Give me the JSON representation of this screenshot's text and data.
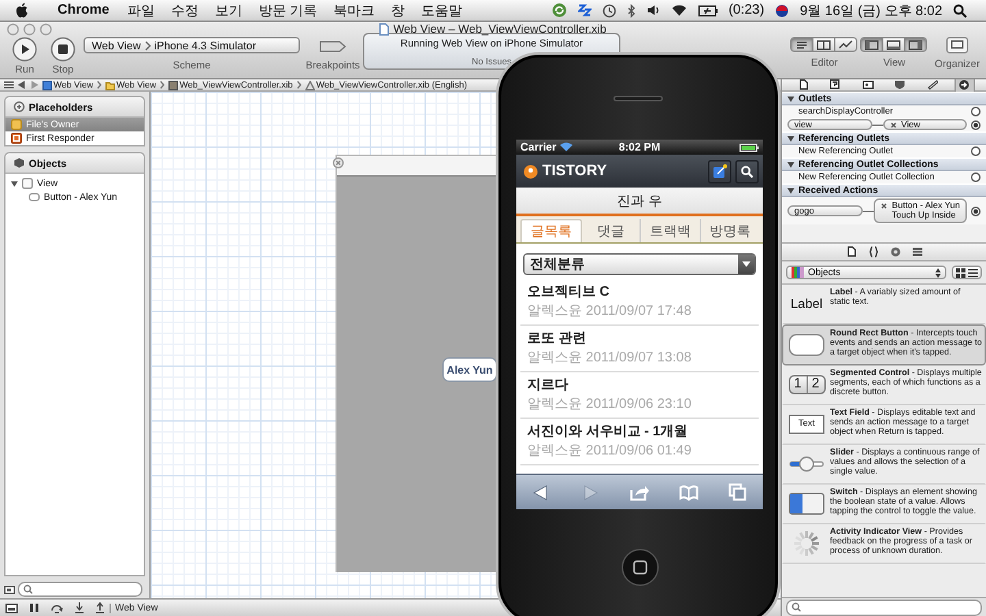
{
  "menu_bar": {
    "app": "Chrome",
    "menus": [
      "파일",
      "수정",
      "보기",
      "방문 기록",
      "북마크",
      "창",
      "도움말"
    ],
    "battery": "(0:23)",
    "clock": "9월 16일 (금) 오후 8:02"
  },
  "window": {
    "title": "Web View – Web_ViewViewController.xib"
  },
  "toolbar": {
    "run": "Run",
    "stop": "Stop",
    "scheme": {
      "target": "Web View",
      "destination": "iPhone 4.3 Simulator",
      "label": "Scheme"
    },
    "breakpoints": "Breakpoints",
    "activity": {
      "status": "Running Web View on iPhone Simulator",
      "issues": "No Issues"
    },
    "editor": {
      "label": "Editor",
      "modes": [
        {
          "selected": true
        },
        {
          "selected": false
        },
        {
          "selected": false
        }
      ]
    },
    "view": {
      "label": "View",
      "panes": [
        {
          "selected": true
        },
        {
          "selected": false
        },
        {
          "selected": true
        }
      ]
    },
    "organizer": "Organizer"
  },
  "jump_bar": {
    "path": [
      "Web View",
      "Web View",
      "Web_ViewViewController.xib",
      "Web_ViewViewController.xib (English)"
    ]
  },
  "outline": {
    "sections": [
      {
        "title": "Placeholders",
        "items": [
          {
            "label": "File's Owner",
            "kind": "owner",
            "selected": true
          },
          {
            "label": "First Responder",
            "kind": "responder",
            "selected": false
          }
        ]
      },
      {
        "title": "Objects",
        "items": [
          {
            "label": "View",
            "kind": "view",
            "selected": false,
            "expanded": true,
            "children": [
              {
                "label": "Button - Alex Yun",
                "kind": "button",
                "selected": false
              }
            ]
          }
        ]
      }
    ]
  },
  "canvas": {
    "button": "Alex Yun"
  },
  "debug_bar": {
    "target": "Web View"
  },
  "simulator": {
    "carrier": "Carrier",
    "time": "8:02 PM",
    "logo": "TISTORY",
    "blog_title": "진과 우",
    "tabs": [
      {
        "label": "글목록",
        "selected": true
      },
      {
        "label": "댓글",
        "selected": false
      },
      {
        "label": "트랙백",
        "selected": false
      },
      {
        "label": "방명록",
        "selected": false
      }
    ],
    "category": "전체분류",
    "posts": [
      {
        "title": "오브젝티브 C",
        "meta": "알렉스윤 2011/09/07 17:48"
      },
      {
        "title": "로또 관련",
        "meta": "알렉스윤 2011/09/07 13:08"
      },
      {
        "title": "지르다",
        "meta": "알렉스윤 2011/09/06 23:10"
      },
      {
        "title": "서진이와 서우비교 - 1개월",
        "meta": "알렉스윤 2011/09/06 01:49"
      }
    ],
    "forward_disabled": true
  },
  "inspector": {
    "tabs": [
      {
        "selected": false
      },
      {
        "selected": false
      },
      {
        "selected": false
      },
      {
        "selected": false
      },
      {
        "selected": false
      },
      {
        "selected": true
      }
    ],
    "sections": [
      {
        "title": "Outlets",
        "rows": [
          {
            "name": "searchDisplayController",
            "connected": false
          },
          {
            "name": "view",
            "connected": true,
            "target": "View"
          }
        ]
      },
      {
        "title": "Referencing Outlets",
        "rows": [
          {
            "name": "New Referencing Outlet",
            "connected": false
          }
        ]
      },
      {
        "title": "Referencing Outlet Collections",
        "rows": [
          {
            "name": "New Referencing Outlet Collection",
            "connected": false
          }
        ]
      },
      {
        "title": "Received Actions",
        "rows": [
          {
            "name": "gogo",
            "connected": true,
            "target": "Button - Alex Yun",
            "event": "Touch Up Inside"
          }
        ]
      }
    ]
  },
  "library": {
    "filter": "Objects",
    "items": [
      {
        "kind": "label",
        "preview": "Label",
        "text": "**Label** - A variably sized amount of static text.",
        "selected": false
      },
      {
        "kind": "button",
        "text": "**Round Rect Button** - Intercepts touch events and sends an action message to a target object when it's tapped.",
        "selected": true
      },
      {
        "kind": "segmented",
        "segments": [
          "1",
          "2"
        ],
        "text": "**Segmented Control** - Displays multiple segments, each of which functions as a discrete button.",
        "selected": false
      },
      {
        "kind": "text_field",
        "preview": "Text",
        "text": "**Text Field** - Displays editable text and sends an action message to a target object when Return is tapped.",
        "selected": false
      },
      {
        "kind": "slider",
        "text": "**Slider** - Displays a continuous range of values and allows the selection of a single value.",
        "selected": false
      },
      {
        "kind": "switch",
        "text": "**Switch** - Displays an element showing the boolean state of a value. Allows tapping the control to toggle the value.",
        "selected": false
      },
      {
        "kind": "activity",
        "text": "**Activity Indicator View** - Provides feedback on the progress of a task or process of unknown duration.",
        "selected": false
      }
    ]
  }
}
